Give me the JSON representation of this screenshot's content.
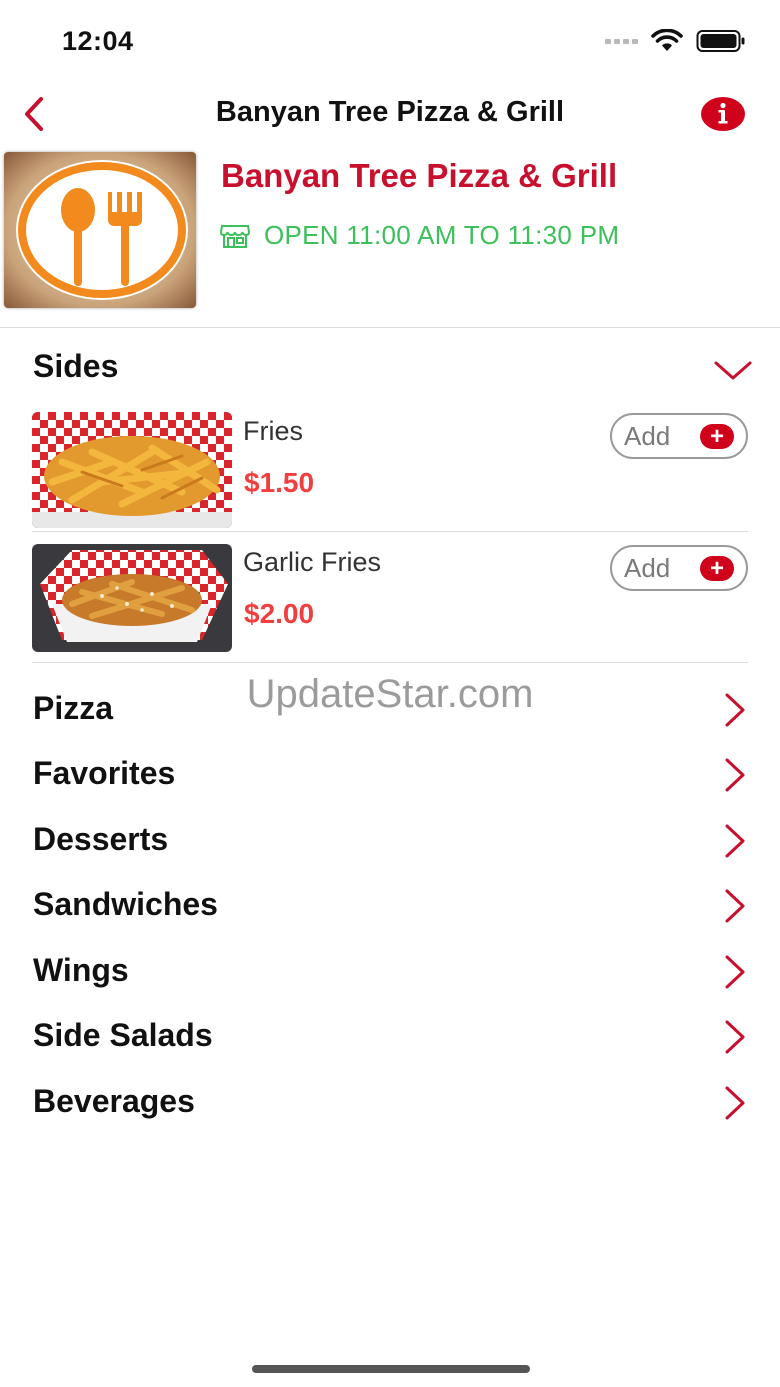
{
  "status_bar": {
    "time": "12:04"
  },
  "nav": {
    "title": "Banyan Tree Pizza & Grill"
  },
  "restaurant": {
    "name": "Banyan Tree Pizza & Grill",
    "hours": "OPEN 11:00 AM TO 11:30 PM"
  },
  "section": {
    "title": "Sides",
    "items": [
      {
        "name": "Fries",
        "price": "$1.50",
        "add_label": "Add"
      },
      {
        "name": "Garlic Fries",
        "price": "$2.00",
        "add_label": "Add"
      }
    ]
  },
  "watermark": "UpdateStar.com",
  "categories": [
    "Pizza",
    "Favorites",
    "Desserts",
    "Sandwiches",
    "Wings",
    "Side Salads",
    "Beverages"
  ],
  "colors": {
    "accent_red": "#c8102e",
    "price_red": "#f23e3e",
    "open_green": "#3cc05a",
    "logo_orange": "#f28a1e"
  },
  "icons": {
    "back": "chevron-left-icon",
    "info": "info-icon",
    "store": "store-icon",
    "expand": "chevron-down-icon",
    "category": "chevron-right-icon",
    "add": "plus-icon"
  }
}
